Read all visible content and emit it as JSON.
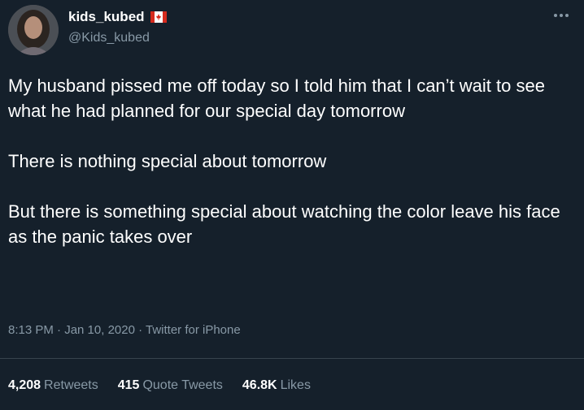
{
  "user": {
    "display_name": "kids_kubed",
    "handle": "@Kids_kubed",
    "badge_icon": "canada-flag-icon"
  },
  "tweet": {
    "paragraphs": [
      "My husband pissed me off today so I told him that I can’t wait to see what he had planned for our special day tomorrow",
      "There is nothing special about tomorrow",
      "But there is something special about watching the color leave his face as the panic takes over"
    ],
    "meta": "8:13 PM · Jan 10, 2020 · Twitter for iPhone"
  },
  "stats": {
    "retweets": {
      "value": "4,208",
      "label": "Retweets"
    },
    "quote_tweets": {
      "value": "415",
      "label": "Quote Tweets"
    },
    "likes": {
      "value": "46.8K",
      "label": "Likes"
    }
  },
  "colors": {
    "background": "#15202b",
    "secondary_text": "#8899a6",
    "divider": "#38444d",
    "flag_red": "#d52b1e"
  }
}
